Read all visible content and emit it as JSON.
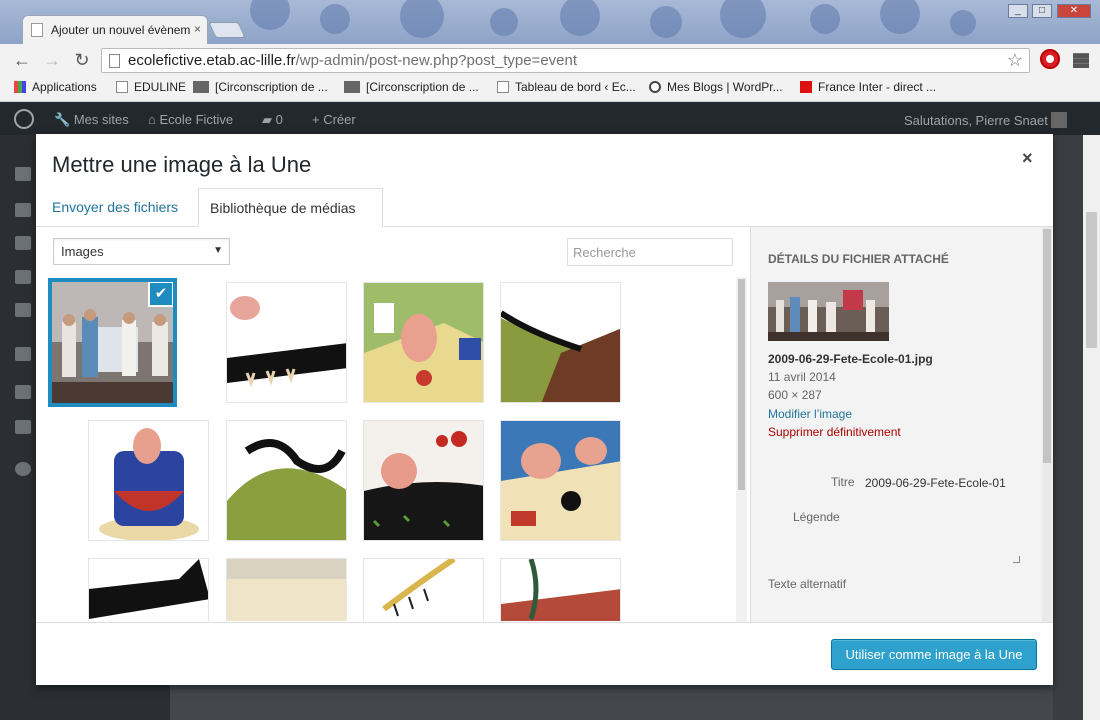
{
  "browser": {
    "tab_title": "Ajouter un nouvel évènem",
    "tab_close": "×",
    "url_host": "ecolefictive.etab.ac-lille.fr",
    "url_path": "/wp-admin/post-new.php?post_type=event",
    "bookmarks": [
      {
        "label": "Applications",
        "icon": "apps-grid-icon"
      },
      {
        "label": "EDULINE",
        "icon": "page-icon"
      },
      {
        "label": "[Circonscription de ...",
        "icon": "site-icon"
      },
      {
        "label": "[Circonscription de ...",
        "icon": "site-icon"
      },
      {
        "label": "Tableau de bord ‹ Ec...",
        "icon": "page-icon"
      },
      {
        "label": "Mes Blogs | WordPr...",
        "icon": "wordpress-icon"
      },
      {
        "label": "France Inter - direct ...",
        "icon": "radio-icon"
      }
    ]
  },
  "adminbar": {
    "mysites": "Mes sites",
    "site": "Ecole Fictive",
    "comments": "0",
    "create": "Créer",
    "greeting": "Salutations, Pierre Snaet"
  },
  "modal": {
    "title": "Mettre une image à la Une",
    "close": "×",
    "tabs": {
      "upload": "Envoyer des fichiers",
      "library": "Bibliothèque de médias"
    },
    "filter_value": "Images",
    "search_placeholder": "Recherche",
    "check": "✔",
    "details": {
      "heading": "Détails du fichier attaché",
      "filename": "2009-06-29-Fete-Ecole-01.jpg",
      "date": "11 avril 2014",
      "dimensions": "600 × 287",
      "edit_link": "Modifier l’image",
      "delete_link": "Supprimer définitivement",
      "title_label": "Titre",
      "title_value": "2009-06-29-Fete-Ecole-01",
      "caption_label": "Légende",
      "alt_label": "Texte alternatif"
    },
    "button": "Utiliser comme image à la Une"
  },
  "colors": {
    "accent": "#1e8cbe",
    "button": "#2ea2cc",
    "delete": "#a00",
    "link": "#21759b"
  }
}
